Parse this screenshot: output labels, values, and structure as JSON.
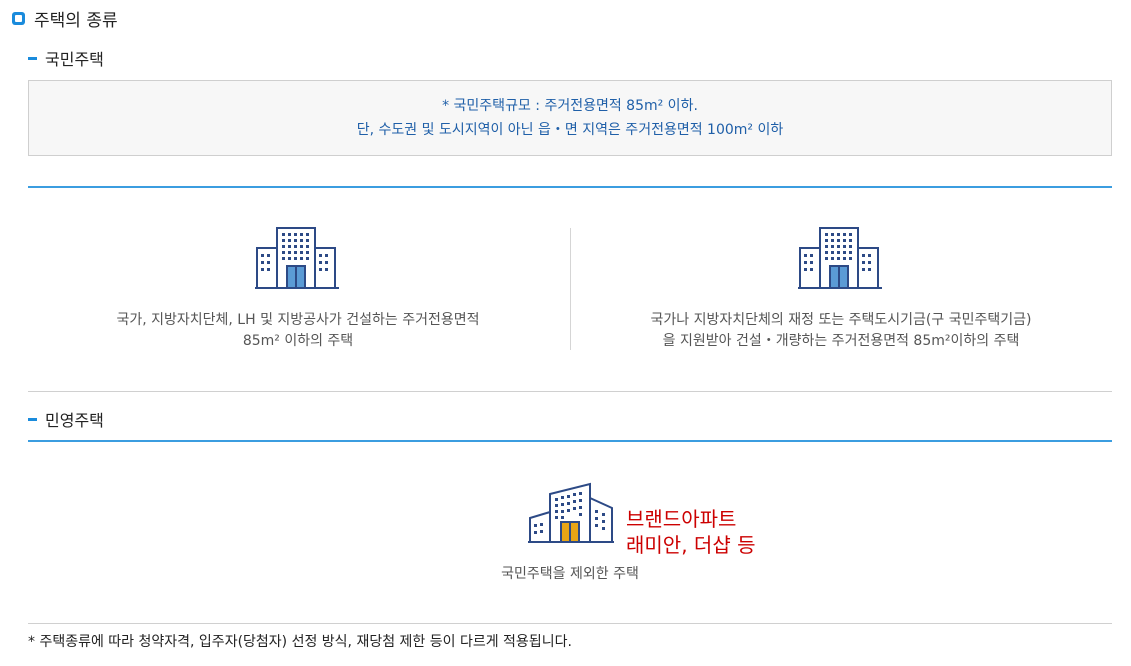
{
  "title": "주택의 종류",
  "public_housing": {
    "heading": "국민주택",
    "notice": {
      "line1": "* 국민주택규모 : 주거전용면적 85m² 이하.",
      "line2": "단, 수도권 및 도시지역이 아닌 읍・면 지역은 주거전용면적 100m² 이하"
    },
    "types": [
      {
        "icon": "building-icon",
        "line1": "국가, 지방자치단체, LH 및 지방공사가 건설하는 주거전용면적",
        "line2": "85m² 이하의 주택"
      },
      {
        "icon": "building-icon",
        "line1": "국가나 지방자치단체의 재정 또는 주택도시기금(구 국민주택기금)",
        "line2": "을 지원받아 건설・개량하는 주거전용면적 85m²이하의 주택"
      }
    ]
  },
  "private_housing": {
    "heading": "민영주택",
    "icon": "apartment-building-icon",
    "brand_line1": "브랜드아파트",
    "brand_line2": "래미안, 더샵 등",
    "description": "국민주택을 제외한 주택"
  },
  "footnote": "* 주택종류에 따라 청약자격, 입주자(당첨자) 선정 방식, 재당첨 제한 등이 다르게 적용됩니다.",
  "colors": {
    "accent_blue": "#1a8bdc",
    "notice_text": "#1f5fa8",
    "icon_navy": "#2d4a86",
    "door_blue": "#5b9bd5",
    "door_gold": "#e8a516",
    "brand_red": "#cc0000"
  }
}
